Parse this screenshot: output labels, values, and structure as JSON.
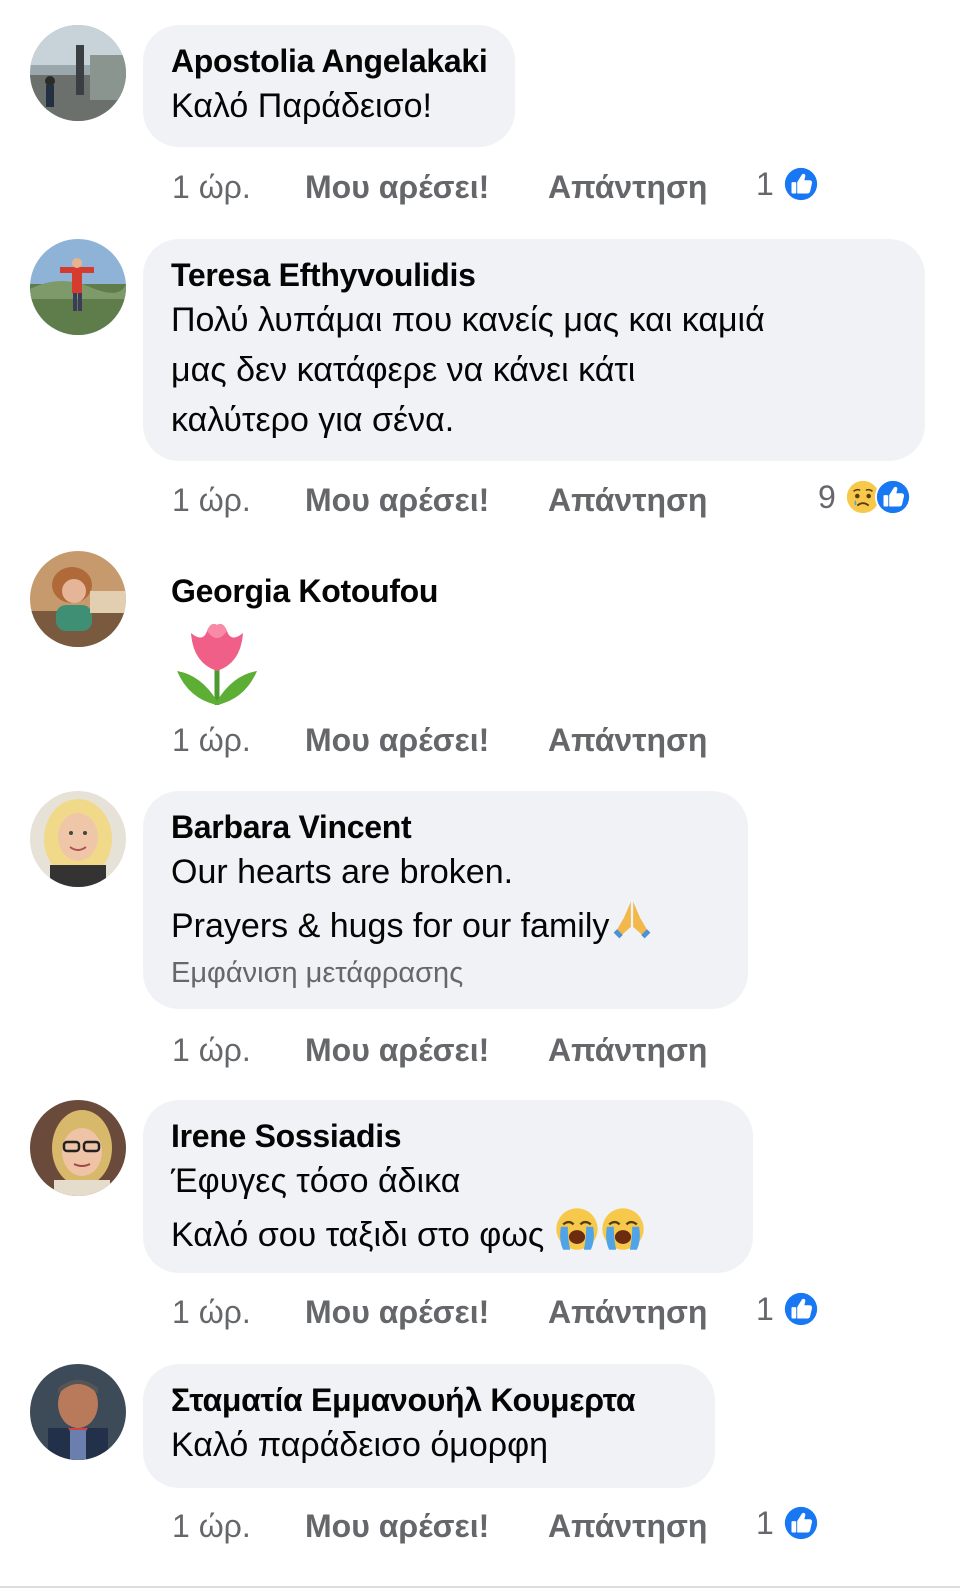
{
  "comments": [
    {
      "author": "Apostolia Angelakaki",
      "lines": [
        "Καλό Παράδεισο!"
      ],
      "time": "1 ώρ.",
      "like": "Μου αρέσει!",
      "reply": "Απάντηση",
      "reaction_count": "1",
      "reactions": [
        "like-icon"
      ]
    },
    {
      "author": "Teresa Efthyvoulidis",
      "lines": [
        "Πολύ λυπάμαι που κανείς μας και καμιά",
        "μας δεν κατάφερε να κάνει κάτι",
        "καλύτερο για σένα."
      ],
      "time": "1 ώρ.",
      "like": "Μου αρέσει!",
      "reply": "Απάντηση",
      "reaction_count": "9",
      "reactions": [
        "sad-icon",
        "like-icon"
      ]
    },
    {
      "author": "Georgia Kotoufou",
      "lines": [],
      "sticker": "tulip-emoji",
      "time": "1 ώρ.",
      "like": "Μου αρέσει!",
      "reply": "Απάντηση"
    },
    {
      "author": "Barbara Vincent",
      "lines": [
        "Our hearts are broken.",
        "Prayers & hugs for our family"
      ],
      "line_emoji": "folded-hands-emoji",
      "see_translation": "Εμφάνιση μετάφρασης",
      "time": "1 ώρ.",
      "like": "Μου αρέσει!",
      "reply": "Απάντηση"
    },
    {
      "author": "Irene Sossiadis",
      "lines": [
        "Έφυγες τόσο άδικα",
        "Καλό σου ταξιδι στο φως "
      ],
      "line_emoji": "loudly-crying-face-emoji",
      "time": "1 ώρ.",
      "like": "Μου αρέσει!",
      "reply": "Απάντηση",
      "reaction_count": "1",
      "reactions": [
        "like-icon"
      ]
    },
    {
      "author": "Σταματία Εμμανουήλ Κουμερτα",
      "lines": [
        "Καλό παράδεισο όμορφη"
      ],
      "time": "1 ώρ.",
      "like": "Μου αρέσει!",
      "reply": "Απάντηση",
      "reaction_count": "1",
      "reactions": [
        "like-icon"
      ]
    }
  ],
  "colors": {
    "bubble": "#f0f2f5",
    "meta_text": "#65676b",
    "like_blue": "#1877f2",
    "sad_yellow": "#f7c94b"
  }
}
